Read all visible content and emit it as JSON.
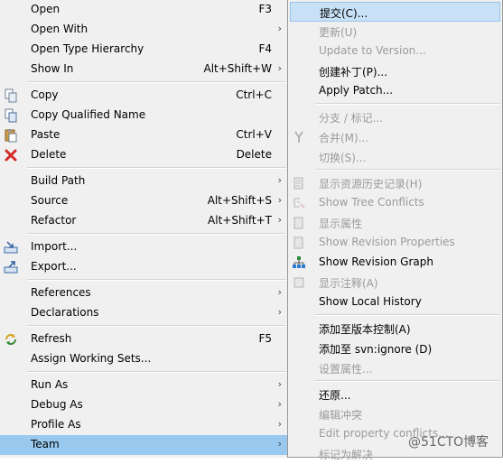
{
  "main_menu": {
    "items": [
      {
        "label": "Open",
        "accel": "F3"
      },
      {
        "label": "Open With",
        "accel": ""
      },
      {
        "label": "Open Type Hierarchy",
        "accel": "F4"
      },
      {
        "label": "Show In",
        "accel": "Alt+Shift+W"
      },
      {
        "label": "Copy",
        "accel": "Ctrl+C"
      },
      {
        "label": "Copy Qualified Name",
        "accel": ""
      },
      {
        "label": "Paste",
        "accel": "Ctrl+V"
      },
      {
        "label": "Delete",
        "accel": "Delete"
      },
      {
        "label": "Build Path",
        "accel": ""
      },
      {
        "label": "Source",
        "accel": "Alt+Shift+S"
      },
      {
        "label": "Refactor",
        "accel": "Alt+Shift+T"
      },
      {
        "label": "Import...",
        "accel": ""
      },
      {
        "label": "Export...",
        "accel": ""
      },
      {
        "label": "References",
        "accel": ""
      },
      {
        "label": "Declarations",
        "accel": ""
      },
      {
        "label": "Refresh",
        "accel": "F5"
      },
      {
        "label": "Assign Working Sets...",
        "accel": ""
      },
      {
        "label": "Run As",
        "accel": ""
      },
      {
        "label": "Debug As",
        "accel": ""
      },
      {
        "label": "Profile As",
        "accel": ""
      },
      {
        "label": "Team",
        "accel": ""
      }
    ]
  },
  "team_submenu": {
    "items": [
      {
        "label": "提交(C)..."
      },
      {
        "label": "更新(U)"
      },
      {
        "label": "Update to Version..."
      },
      {
        "label": "创建补丁(P)..."
      },
      {
        "label": "Apply Patch..."
      },
      {
        "label": "分支 / 标记..."
      },
      {
        "label": "合并(M)..."
      },
      {
        "label": "切换(S)..."
      },
      {
        "label": "显示资源历史记录(H)"
      },
      {
        "label": "Show Tree Conflicts"
      },
      {
        "label": "显示属性"
      },
      {
        "label": "Show Revision Properties"
      },
      {
        "label": "Show Revision Graph"
      },
      {
        "label": "显示注释(A)"
      },
      {
        "label": "Show Local History"
      },
      {
        "label": "添加至版本控制(A)"
      },
      {
        "label": "添加至 svn:ignore (D)"
      },
      {
        "label": "设置属性..."
      },
      {
        "label": "还原..."
      },
      {
        "label": "编辑冲突"
      },
      {
        "label": "Edit property conflicts..."
      },
      {
        "label": "标记为解决"
      }
    ]
  },
  "watermark": "@51CTO博客",
  "colors": {
    "highlight": "#99c9ef",
    "menu_bg": "#f0f0f0",
    "disabled_text": "#9b9b9b"
  }
}
